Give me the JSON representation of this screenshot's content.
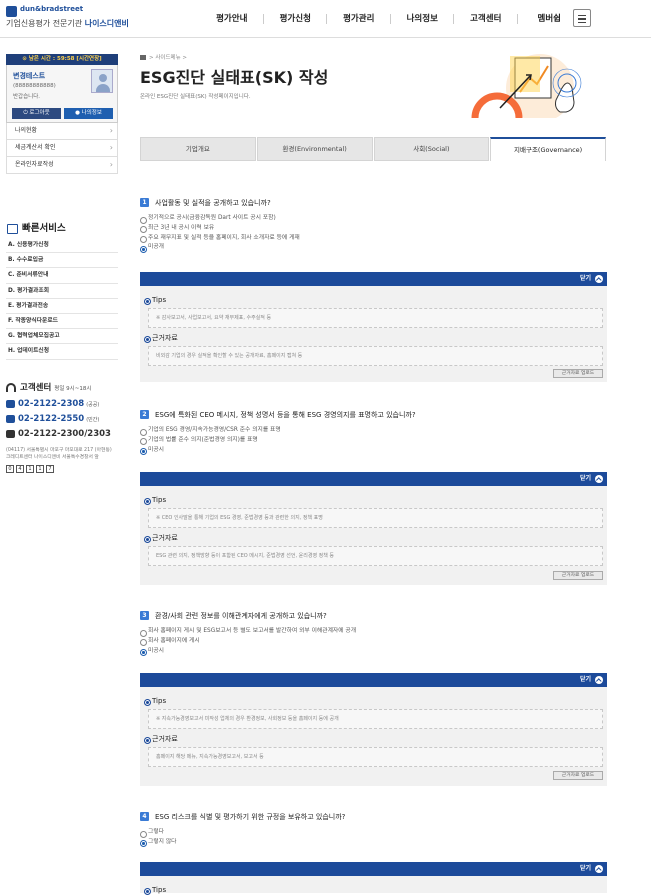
{
  "header": {
    "logo_brand": "dun&bradstreet",
    "logo_line": "기업신용평가 전문기관",
    "logo_name": "나이스디앤비",
    "nav": [
      "평가안내",
      "평가신청",
      "평가관리",
      "나의정보",
      "고객센터",
      "멤버쉽"
    ]
  },
  "sidebar": {
    "timer": "⊙ 남은 시간 : 59:58 [시간연장]",
    "user_name": "변경테스트",
    "user_phone": "(88888888888)",
    "welcome": "반갑습니다.",
    "logout_label": "로그아웃",
    "myinfo_label": "나의정보",
    "menu": [
      "나의현황",
      "세금계산서 확인",
      "온라인자료작성"
    ],
    "quick_title": "빠른서비스",
    "quick_items": [
      "A. 신용평가신청",
      "B. 수수료입금",
      "C. 준비서류안내",
      "D. 평가결과조회",
      "E. 평가결과전송",
      "F. 작종양식다운로드",
      "G. 협력업체모집공고",
      "H. 업데이트신청"
    ],
    "cs_title": "고객센터",
    "cs_hours": "평일 9시~18시",
    "tel1": "02-2122-2308",
    "tel1_note": "(공공)",
    "tel2": "02-2122-2550",
    "tel2_note": "(민간)",
    "fax": "02-2122-2300/2303",
    "address": "(04117) 서울특별시 마포구 마포대로 217 (아현동) 크레디트센터 나이스디앤비 서울특수경찰서 앞",
    "code_boxes": [
      "0",
      "4",
      "1",
      "1",
      "7"
    ]
  },
  "main": {
    "breadcrumb": "> 사이드메뉴 >",
    "title": "ESG진단 실태표(SK) 작성",
    "subtitle": "온라인 ESG진단 실태표(SK) 작성페이지입니다.",
    "tabs": [
      "기업개요",
      "환경(Environmental)",
      "사회(Social)",
      "지배구조(Governance)"
    ],
    "active_tab": 3
  },
  "questions": [
    {
      "num": "1",
      "text": "사업활동 및 실적을 공개하고 있습니까?",
      "options": [
        "정기적으로 공시(금융감독원 Dart 사이트 공시 포함)",
        "최근 3년 내 공시 이력 보유",
        "주요 재무지표 및 실적 등을 홈페이지, 회사 소개자료 등에 게재",
        "미공개"
      ],
      "selected": 3,
      "tips": "※ 감사보고서, 사업보고서, 요약 재무제표, 수주실적 등",
      "basis": "비외감 기업의 경우 실적을 확인할 수 있는 공개자료, 홈페이지 캡쳐 등"
    },
    {
      "num": "2",
      "text": "ESG에 특화된 CEO 메시지, 정책 성명서 등을 통해 ESG 경영의지를 표명하고 있습니까?",
      "options": [
        "기업의 ESG 경영/지속가능경영/CSR 준수 의지를 표명",
        "기업의 법률 준수 의지(준법경영 의지)를 표명",
        "미공시"
      ],
      "selected": 2,
      "tips": "※ CEO 인사말을 통해 기업의 ESG 경영, 준법경영 등과 관련한 의지, 정책 표명",
      "basis": "ESG 관련 의지, 정책방향 등이 포함된 CEO 메시지, 준법경영 선언, 윤리경영 정책 등"
    },
    {
      "num": "3",
      "text": "환경/사회 관련 정보를 이해관계자에게 공개하고 있습니까?",
      "options": [
        "회사 홈페이지 게시 및 ESG보고서 등 별도 보고서를 발간하여 외부 이해관계자에 공개",
        "회사 홈페이지에 게시",
        "미공시"
      ],
      "selected": 2,
      "tips": "※ 지속가능경영보고서 미작성 업체의 경우 환경정보, 사회정보 등을 홈페이지 등에 공개",
      "basis": "홈페이지 해당 메뉴, 지속가능경영보고서, 보고서 등"
    },
    {
      "num": "4",
      "text": "ESG 리스크를 식별 및 평가하기 위한 규정을 보유하고 있습니까?",
      "options": [
        "그렇다",
        "그렇지 않다"
      ],
      "selected": 1,
      "tips": "",
      "basis": ""
    }
  ],
  "labels": {
    "close": "닫기",
    "tips": "Tips",
    "basis": "근거자료",
    "attach_btn": "근거자료 업로드"
  }
}
